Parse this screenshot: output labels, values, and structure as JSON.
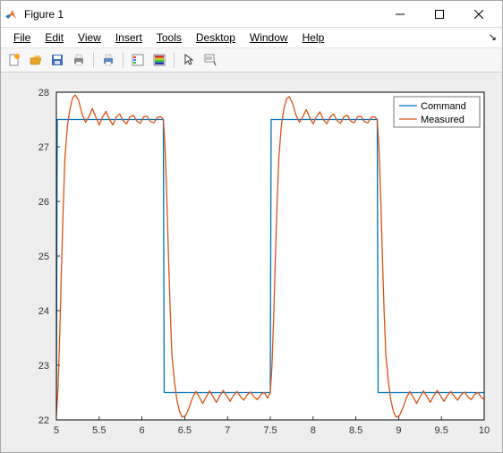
{
  "window": {
    "title": "Figure 1"
  },
  "menu": {
    "file": "File",
    "edit": "Edit",
    "view": "View",
    "insert": "Insert",
    "tools": "Tools",
    "desktop": "Desktop",
    "window": "Window",
    "help": "Help"
  },
  "toolbar_icons": {
    "new": "new-figure-icon",
    "open": "open-file-icon",
    "save": "save-icon",
    "print": "print-icon",
    "sep1": "",
    "print2": "pagepreview-icon",
    "sep2": "",
    "legend_toggle": "legend-icon",
    "colorbar": "colorbar-icon",
    "sep3": "",
    "cursor": "pointer-icon",
    "datatips": "datatip-icon"
  },
  "chart_data": {
    "type": "line",
    "xlabel": "",
    "ylabel": "",
    "xlim": [
      5,
      10
    ],
    "ylim": [
      22,
      28
    ],
    "xticks": [
      5,
      5.5,
      6,
      6.5,
      7,
      7.5,
      8,
      8.5,
      9,
      9.5,
      10
    ],
    "yticks": [
      22,
      23,
      24,
      25,
      26,
      27,
      28
    ],
    "legend": {
      "entries": [
        "Command",
        "Measured"
      ],
      "position": "northeast"
    },
    "series": [
      {
        "name": "Command",
        "color": "#0072bd",
        "x": [
          5,
          5.01,
          6.25,
          6.26,
          7.5,
          7.51,
          8.75,
          8.76,
          10
        ],
        "y": [
          22.5,
          27.5,
          27.5,
          22.5,
          22.5,
          27.5,
          27.5,
          22.5,
          22.5
        ]
      },
      {
        "name": "Measured",
        "color": "#d95319",
        "x": [
          5.0,
          5.02,
          5.04,
          5.06,
          5.08,
          5.1,
          5.13,
          5.16,
          5.19,
          5.22,
          5.26,
          5.3,
          5.34,
          5.38,
          5.42,
          5.46,
          5.5,
          5.54,
          5.58,
          5.62,
          5.66,
          5.7,
          5.74,
          5.78,
          5.82,
          5.86,
          5.9,
          5.94,
          5.98,
          6.02,
          6.06,
          6.1,
          6.14,
          6.18,
          6.22,
          6.25,
          6.27,
          6.29,
          6.31,
          6.33,
          6.35,
          6.38,
          6.41,
          6.44,
          6.47,
          6.51,
          6.55,
          6.59,
          6.63,
          6.67,
          6.71,
          6.75,
          6.79,
          6.83,
          6.87,
          6.91,
          6.95,
          6.99,
          7.03,
          7.07,
          7.11,
          7.15,
          7.19,
          7.23,
          7.27,
          7.31,
          7.35,
          7.39,
          7.43,
          7.47,
          7.5,
          7.52,
          7.54,
          7.56,
          7.58,
          7.6,
          7.63,
          7.66,
          7.69,
          7.72,
          7.76,
          7.8,
          7.84,
          7.88,
          7.92,
          7.96,
          8.0,
          8.04,
          8.08,
          8.12,
          8.16,
          8.2,
          8.24,
          8.28,
          8.32,
          8.36,
          8.4,
          8.44,
          8.48,
          8.52,
          8.56,
          8.6,
          8.64,
          8.68,
          8.72,
          8.75,
          8.77,
          8.79,
          8.81,
          8.83,
          8.85,
          8.88,
          8.91,
          8.94,
          8.97,
          9.01,
          9.05,
          9.09,
          9.13,
          9.17,
          9.21,
          9.25,
          9.29,
          9.33,
          9.37,
          9.41,
          9.45,
          9.49,
          9.53,
          9.57,
          9.61,
          9.65,
          9.69,
          9.73,
          9.77,
          9.81,
          9.85,
          9.89,
          9.93,
          9.97,
          10.0
        ],
        "y": [
          22.1,
          22.6,
          23.6,
          24.8,
          25.9,
          26.8,
          27.4,
          27.7,
          27.9,
          27.95,
          27.85,
          27.6,
          27.45,
          27.55,
          27.7,
          27.55,
          27.4,
          27.55,
          27.65,
          27.5,
          27.4,
          27.55,
          27.6,
          27.48,
          27.42,
          27.55,
          27.58,
          27.47,
          27.43,
          27.55,
          27.56,
          27.46,
          27.44,
          27.54,
          27.55,
          27.5,
          27.0,
          26.1,
          25.0,
          24.0,
          23.2,
          22.7,
          22.35,
          22.15,
          22.05,
          22.08,
          22.22,
          22.4,
          22.52,
          22.42,
          22.3,
          22.42,
          22.53,
          22.43,
          22.32,
          22.44,
          22.54,
          22.44,
          22.34,
          22.45,
          22.52,
          22.43,
          22.36,
          22.46,
          22.51,
          22.42,
          22.37,
          22.47,
          22.5,
          22.4,
          22.5,
          23.0,
          23.9,
          25.0,
          26.0,
          26.8,
          27.4,
          27.7,
          27.88,
          27.92,
          27.8,
          27.58,
          27.45,
          27.55,
          27.68,
          27.54,
          27.42,
          27.55,
          27.64,
          27.5,
          27.42,
          27.55,
          27.6,
          27.48,
          27.43,
          27.55,
          27.58,
          27.47,
          27.44,
          27.55,
          27.56,
          27.46,
          27.44,
          27.54,
          27.55,
          27.5,
          27.0,
          26.1,
          25.0,
          24.0,
          23.2,
          22.7,
          22.35,
          22.15,
          22.05,
          22.08,
          22.22,
          22.4,
          22.52,
          22.42,
          22.3,
          22.42,
          22.53,
          22.43,
          22.32,
          22.44,
          22.54,
          22.44,
          22.34,
          22.45,
          22.52,
          22.43,
          22.36,
          22.46,
          22.51,
          22.42,
          22.37,
          22.47,
          22.5,
          22.4,
          22.38
        ]
      }
    ]
  }
}
